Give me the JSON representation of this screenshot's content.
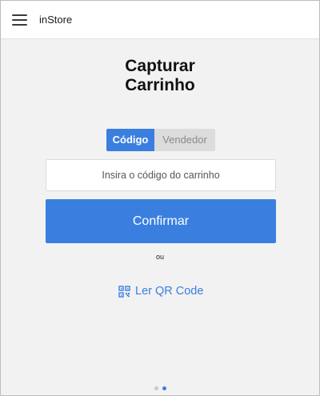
{
  "header": {
    "menu_icon": "hamburger-menu-icon",
    "app_title": "inStore"
  },
  "main": {
    "title_line1": "Capturar",
    "title_line2": "Carrinho",
    "tabs": [
      {
        "label": "Código",
        "active": true
      },
      {
        "label": "Vendedor",
        "active": false
      }
    ],
    "code_input": {
      "placeholder": "Insira o código do carrinho",
      "value": ""
    },
    "confirm_label": "Confirmar",
    "or_label": "ou",
    "qr_link": {
      "icon": "qr-code-icon",
      "label": "Ler QR Code"
    }
  },
  "pagination": {
    "total": 2,
    "active_index": 1
  },
  "colors": {
    "accent": "#3a7fe0",
    "background": "#f2f2f2",
    "tab_inactive_bg": "#dcdcdc",
    "tab_inactive_text": "#8a8a8a"
  }
}
